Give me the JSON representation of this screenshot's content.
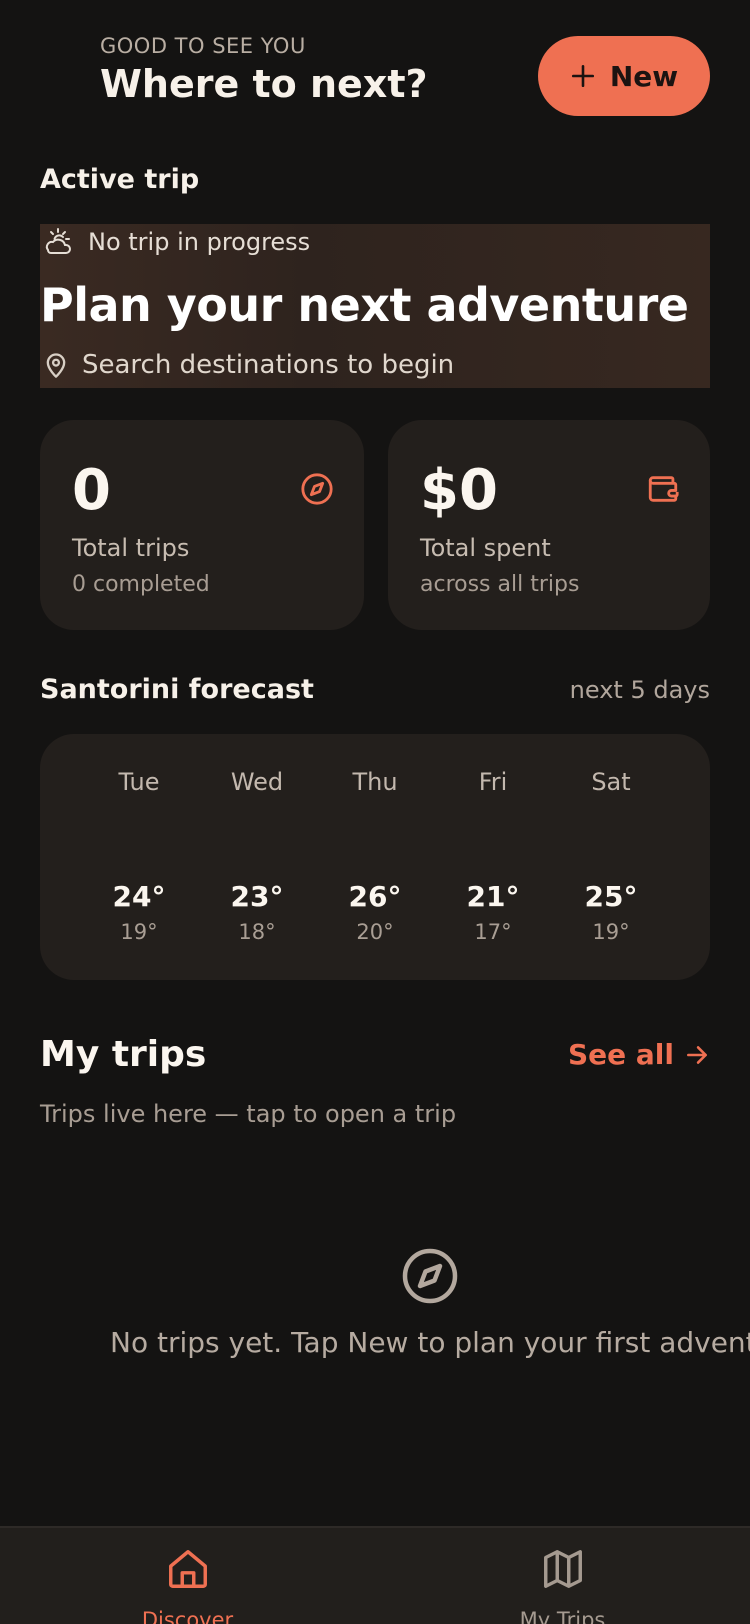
{
  "header": {
    "greeting": "GOOD TO SEE YOU",
    "headline": "Where to next?",
    "new_button_label": "New"
  },
  "active_trip": {
    "section_label": "Active trip",
    "status": "No trip in progress",
    "title": "Plan your next adventure",
    "subtitle": "Search destinations to begin"
  },
  "stats": [
    {
      "value": "0",
      "label": "Total trips",
      "sub": "0 completed",
      "icon": "compass-icon"
    },
    {
      "value": "$0",
      "label": "Total spent",
      "sub": "across all trips",
      "icon": "wallet-icon"
    }
  ],
  "forecast": {
    "title": "Santorini forecast",
    "range": "next 5 days",
    "days": [
      {
        "name": "Tue",
        "high": "24°",
        "low": "19°"
      },
      {
        "name": "Wed",
        "high": "23°",
        "low": "18°"
      },
      {
        "name": "Thu",
        "high": "26°",
        "low": "20°"
      },
      {
        "name": "Fri",
        "high": "21°",
        "low": "17°"
      },
      {
        "name": "Sat",
        "high": "25°",
        "low": "19°"
      }
    ]
  },
  "my_trips": {
    "title": "My trips",
    "see_all": "See all",
    "subtitle": "Trips live here — tap to open a trip",
    "empty_text": "No trips yet. Tap New to plan your first adventure"
  },
  "nav": {
    "items": [
      {
        "label": "Discover",
        "icon": "home-icon",
        "active": true
      },
      {
        "label": "My Trips",
        "icon": "map-icon",
        "active": false
      }
    ]
  },
  "colors": {
    "accent": "#ef7052",
    "background": "#141312",
    "card": "#231f1c"
  }
}
